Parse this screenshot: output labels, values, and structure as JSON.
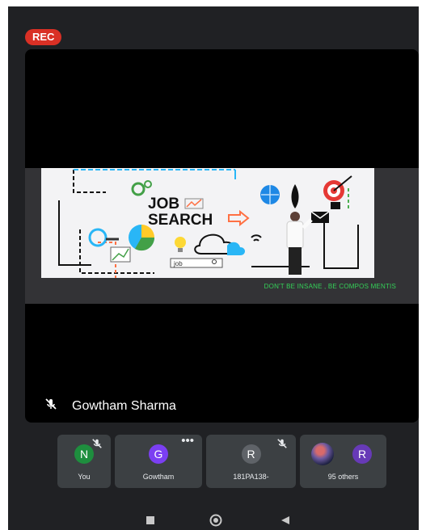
{
  "status": {
    "rec_label": "REC"
  },
  "share": {
    "slide_title_line1": "JOB",
    "slide_title_line2": "SEARCH",
    "search_box_text": "job",
    "caption": "DON'T BE INSANE , BE COMPOS MENTIS"
  },
  "speaker": {
    "name": "Gowtham Sharma"
  },
  "participants": [
    {
      "initial": "N",
      "label": "You",
      "color": "#1e8e3e",
      "muted": true
    },
    {
      "initial": "G",
      "label": "Gowtham",
      "color": "#7b3ff2",
      "muted": false
    },
    {
      "initial": "R",
      "label": "181PA138-",
      "color": "#5f6368",
      "muted": true
    },
    {
      "initial": "R",
      "label": "95 others",
      "color": "#673ab7",
      "muted": false
    }
  ],
  "colors": {
    "rec": "#d93025",
    "caption": "#34d058",
    "background": "#202124"
  },
  "icons": {
    "nav": [
      "recents-icon",
      "home-icon",
      "back-icon"
    ]
  }
}
